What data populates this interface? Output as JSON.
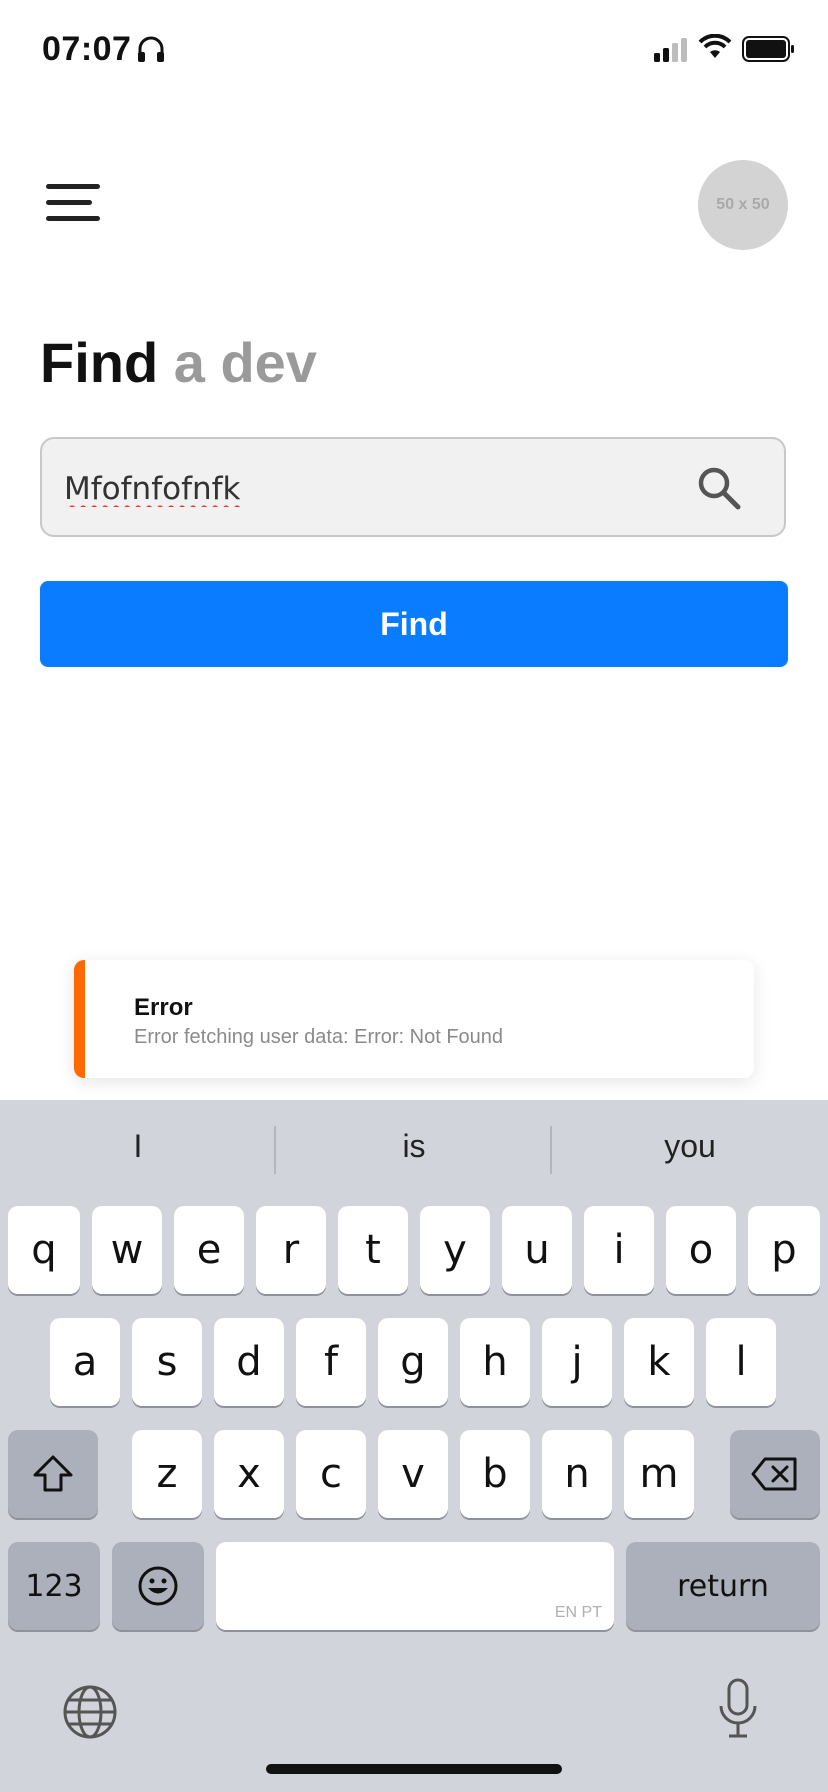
{
  "status_bar": {
    "time": "07:07"
  },
  "header": {
    "avatar_text": "50 x 50"
  },
  "title": {
    "bold": "Find",
    "light": "a dev"
  },
  "search": {
    "value": "Mfofnfofnfk",
    "button_label": "Find"
  },
  "toast": {
    "title": "Error",
    "message": "Error fetching user data: Error: Not Found",
    "accent_color": "#ff6a00"
  },
  "keyboard": {
    "suggestions": [
      "I",
      "is",
      "you"
    ],
    "row1": [
      "q",
      "w",
      "e",
      "r",
      "t",
      "y",
      "u",
      "i",
      "o",
      "p"
    ],
    "row2": [
      "a",
      "s",
      "d",
      "f",
      "g",
      "h",
      "j",
      "k",
      "l"
    ],
    "row3": [
      "z",
      "x",
      "c",
      "v",
      "b",
      "n",
      "m"
    ],
    "numbers_label": "123",
    "return_label": "return",
    "space_languages": "EN PT"
  },
  "colors": {
    "primary": "#0a7cff",
    "background": "#ffffff",
    "keyboard_bg": "#d1d4db"
  }
}
